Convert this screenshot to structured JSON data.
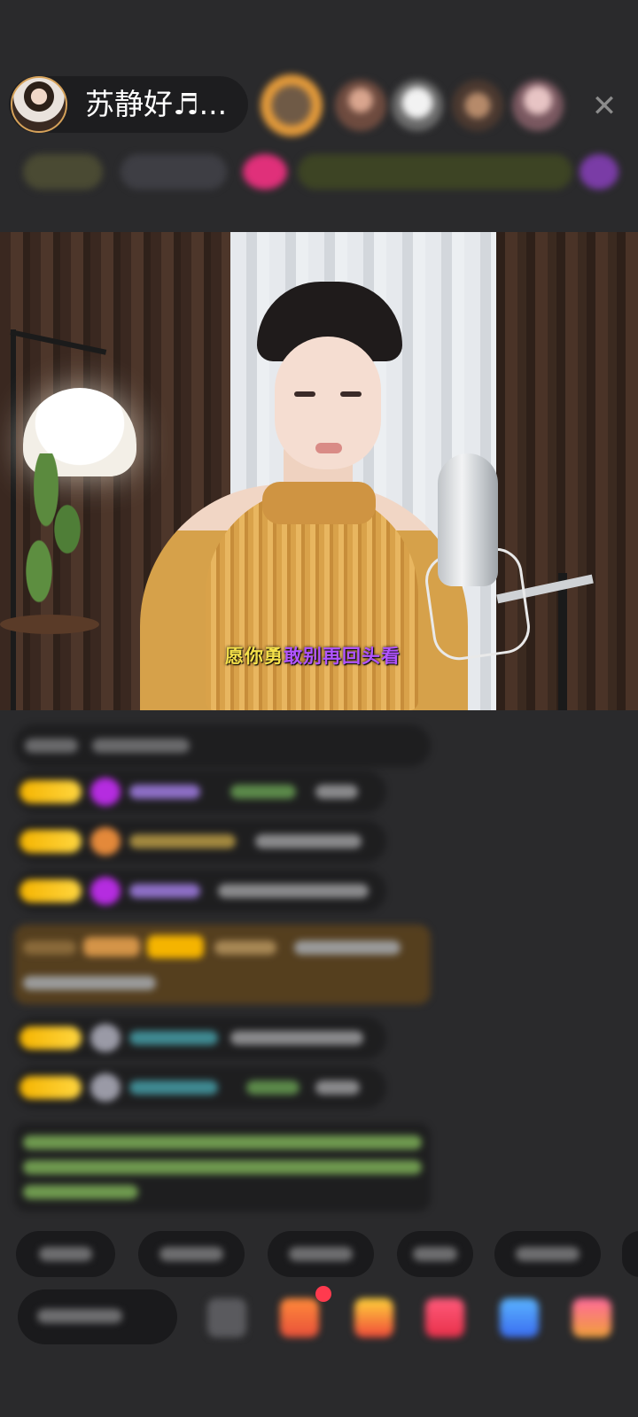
{
  "header": {
    "host_name": "苏静好♬...",
    "close_symbol": "✕"
  },
  "video": {
    "lyric_sung": "愿你勇",
    "lyric_unsung": "敢别再回头看"
  },
  "colors": {
    "background": "#2a2a2c",
    "lyric_sung": "#f4e04a",
    "lyric_unsung": "#b155ff",
    "level_badge": "#f5b400"
  },
  "icons": {
    "close": "close-icon",
    "gift": "gift-icon",
    "emoji": "emoji-icon"
  }
}
